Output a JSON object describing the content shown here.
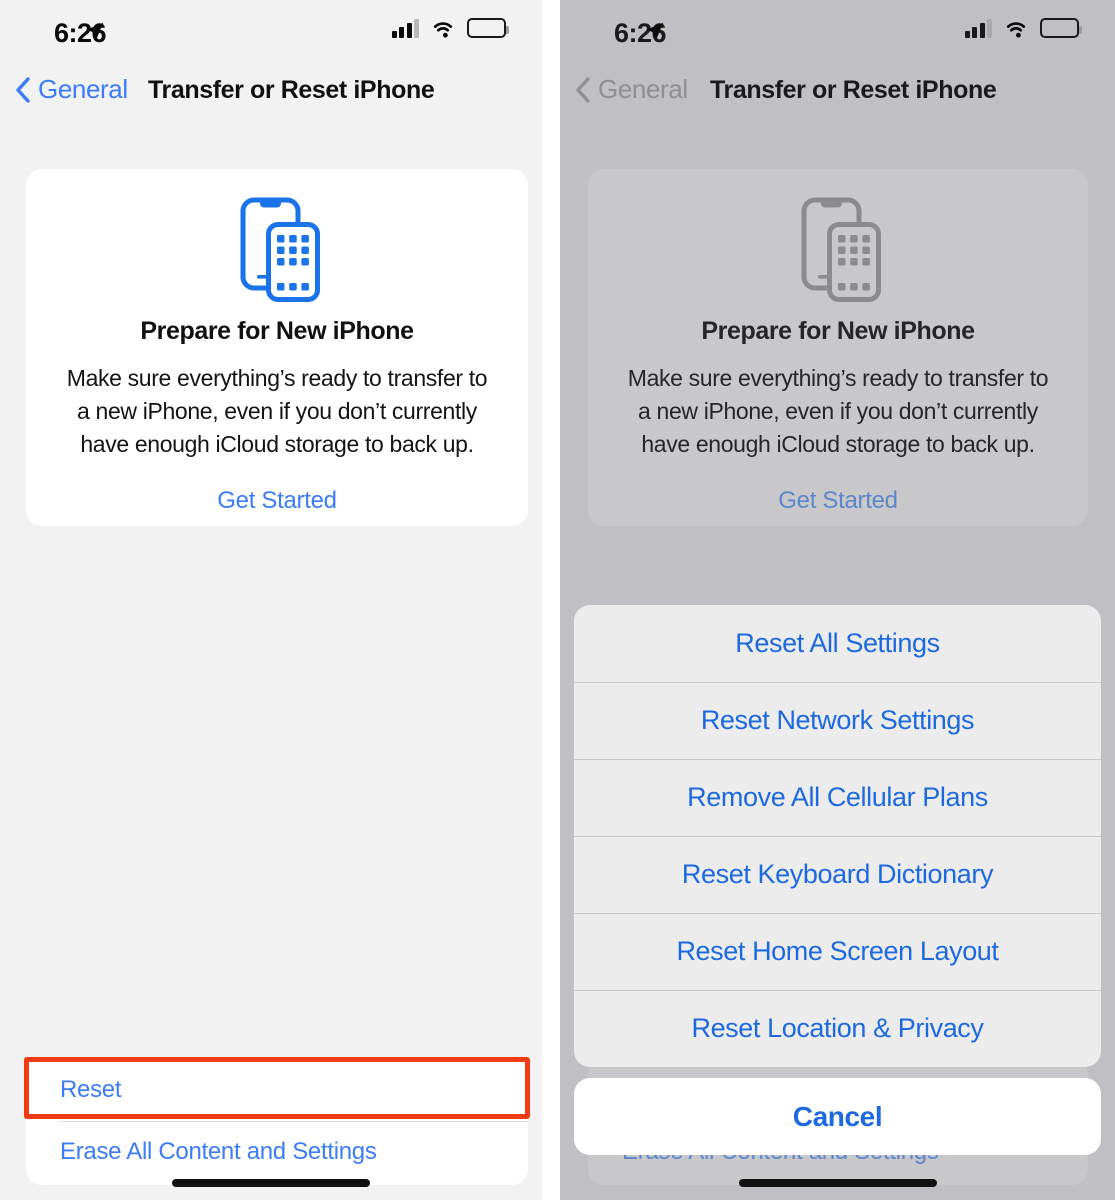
{
  "status_bar": {
    "time": "6:26",
    "location_icon": "location-arrow-icon",
    "cellular_icon": "cellular-bars-icon",
    "cellular_bars_filled": 3,
    "cellular_bars_total": 4,
    "wifi_icon": "wifi-icon",
    "battery_icon": "battery-full-icon"
  },
  "nav": {
    "back_label": "General",
    "back_icon": "chevron-left-icon",
    "title": "Transfer or Reset iPhone"
  },
  "prepare_card": {
    "icon": "two-iphones-icon",
    "title": "Prepare for New iPhone",
    "body": "Make sure everything’s ready to transfer to a new iPhone, even if you don’t currently have enough iCloud storage to back up.",
    "cta_label": "Get Started"
  },
  "bottom_group": {
    "rows": [
      {
        "label": "Reset",
        "highlighted": true
      },
      {
        "label": "Erase All Content and Settings",
        "highlighted": false
      }
    ]
  },
  "action_sheet": {
    "items": [
      {
        "label": "Reset All Settings"
      },
      {
        "label": "Reset Network Settings"
      },
      {
        "label": "Remove All Cellular Plans"
      },
      {
        "label": "Reset Keyboard Dictionary"
      },
      {
        "label": "Reset Home Screen Layout"
      },
      {
        "label": "Reset Location & Privacy"
      }
    ],
    "cancel_label": "Cancel",
    "obscured_row_label": "Erase All Content and Settings"
  },
  "annotation": {
    "color": "#f03c12",
    "target": "Reset"
  },
  "colors": {
    "accent_blue": "#3b7df6",
    "sheet_blue": "#1d6ae0",
    "panel_bg": "#f2f2f3",
    "dimmed_bg": "#bfbfc4",
    "dimmed_card": "#c8c8cb",
    "annotation_red": "#f03c12"
  }
}
